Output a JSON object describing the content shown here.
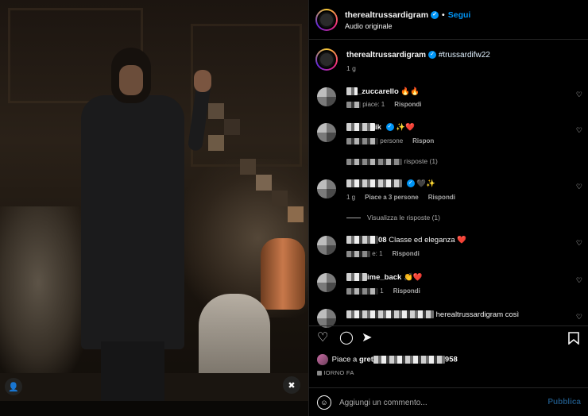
{
  "post": {
    "username": "therealtrussardigram",
    "follow_label": "Segui",
    "separator": "•",
    "audio": "Audio originale",
    "caption_username": "therealtrussardigram",
    "caption_text": "#trussardifw22",
    "caption_time": "1 g"
  },
  "comments": [
    {
      "user": "_zuccarello",
      "text": "🔥🔥",
      "meta_likes": "piace: 1",
      "meta_reply": "Rispondi"
    },
    {
      "user": "ik",
      "text": "✨❤️",
      "meta_likes": "persone",
      "meta_reply": "Rispon",
      "view_replies": "risposte (1)"
    },
    {
      "user": "",
      "text": "🖤✨",
      "meta_time": "1 g",
      "meta_likes": "Piace a 3 persone",
      "meta_reply": "Rispondi",
      "view_replies": "Visualizza le risposte (1)"
    },
    {
      "user": "08",
      "text": "Classe ed eleganza ❤️",
      "meta_likes": "e: 1",
      "meta_reply": "Rispondi"
    },
    {
      "user": "ime_back",
      "text": "👏❤️",
      "meta_likes": "1",
      "meta_reply": "Rispondi"
    },
    {
      "user": "",
      "text": "herealtrussardigram così"
    }
  ],
  "likes": {
    "prefix": "Piace a",
    "user_fragment": "gret",
    "suffix": "958"
  },
  "date_label": "IORNO FA",
  "composer": {
    "placeholder": "Aggiungi un commento...",
    "publish_label": "Pubblica"
  },
  "icons": {
    "verified": "verified-badge-icon",
    "heart": "heart-icon",
    "comment": "comment-icon",
    "share": "share-icon",
    "bookmark": "bookmark-icon",
    "emoji": "emoji-icon",
    "mute": "mute-icon",
    "user": "user-tag-icon"
  },
  "colors": {
    "accent": "#0095f6",
    "publish_disabled": "#1c4f78",
    "secondary_text": "#a8a8a8"
  }
}
